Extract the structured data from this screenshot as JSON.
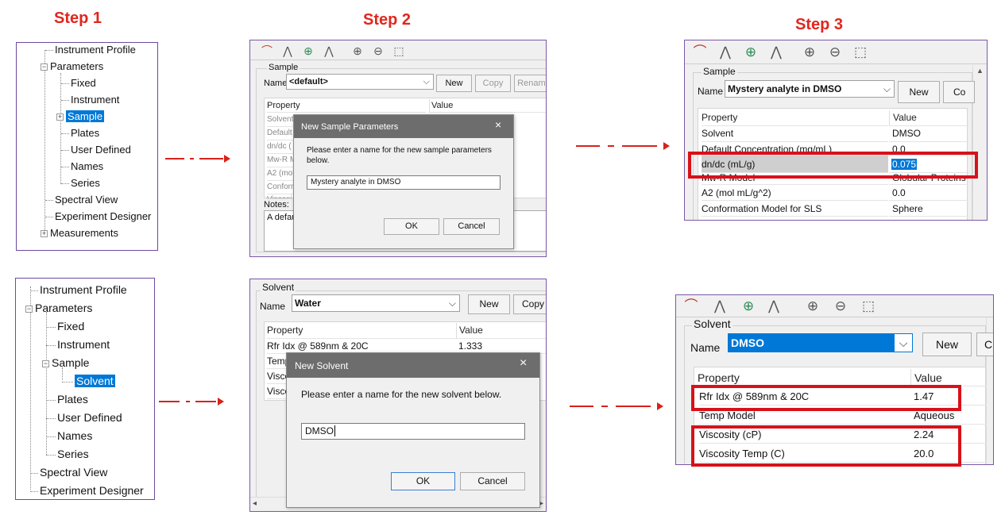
{
  "steps": {
    "s1": "Step 1",
    "s2": "Step 2",
    "s3": "Step 3"
  },
  "colors": {
    "accent_red": "#d8111a",
    "selection": "#0078d7",
    "dialog_title": "#6d6d6d"
  },
  "tree_top": {
    "items": [
      "Instrument Profile",
      "Parameters",
      "Fixed",
      "Instrument",
      "Sample",
      "Plates",
      "User Defined",
      "Names",
      "Series",
      "Spectral View",
      "Experiment Designer",
      "Measurements"
    ],
    "selected": "Sample"
  },
  "tree_bottom": {
    "items": [
      "Instrument Profile",
      "Parameters",
      "Fixed",
      "Instrument",
      "Sample",
      "Solvent",
      "Plates",
      "User Defined",
      "Names",
      "Series",
      "Spectral View",
      "Experiment Designer"
    ],
    "selected": "Solvent"
  },
  "sample_panel": {
    "group_label": "Sample",
    "name_label": "Name",
    "name_value": "<default>",
    "buttons": {
      "new": "New",
      "copy": "Copy",
      "rename": "Rename"
    },
    "col_property": "Property",
    "col_value": "Value",
    "rows_truncated": [
      "Solvent",
      "Default",
      "dn/dc (",
      "Mw-R M",
      "A2 (mol",
      "Conform",
      "Viscosi"
    ],
    "notes_label": "Notes:",
    "notes_text": "A defau"
  },
  "dialog_sample": {
    "title": "New Sample Parameters",
    "close": "×",
    "message": "Please enter a name for the new sample parameters below.",
    "input": "Mystery analyte in DMSO",
    "ok": "OK",
    "cancel": "Cancel"
  },
  "step3_sample": {
    "group_label": "Sample",
    "name_label": "Name",
    "name_value": "Mystery analyte in DMSO",
    "buttons": {
      "new": "New",
      "copy": "Co"
    },
    "col_property": "Property",
    "col_value": "Value",
    "rows": [
      {
        "property": "Solvent",
        "value": "DMSO"
      },
      {
        "property": "Default Concentration (mg/mL)",
        "value": "0.0"
      },
      {
        "property": "dn/dc (mL/g)",
        "value": "0.075"
      },
      {
        "property": "Mw-R Model",
        "value": "Globular Proteins"
      },
      {
        "property": "A2 (mol mL/g^2)",
        "value": "0.0"
      },
      {
        "property": "Conformation Model for SLS",
        "value": "Sphere"
      }
    ]
  },
  "solvent_panel": {
    "group_label": "Solvent",
    "name_label": "Name",
    "name_value": "Water",
    "buttons": {
      "new": "New",
      "copy": "Copy"
    },
    "col_property": "Property",
    "col_value": "Value",
    "rows_truncated": [
      "Rfr Idx @ 589nm & 20C",
      "Temp",
      "Viscos",
      "Visco"
    ],
    "value_first": "1.333"
  },
  "dialog_solvent": {
    "title": "New Solvent",
    "close": "×",
    "message": "Please enter a name for the new solvent below.",
    "input": "DMSO",
    "ok": "OK",
    "cancel": "Cancel"
  },
  "step3_solvent": {
    "group_label": "Solvent",
    "name_label": "Name",
    "name_value": "DMSO",
    "buttons": {
      "new": "New",
      "copy": "C"
    },
    "col_property": "Property",
    "col_value": "Value",
    "rows": [
      {
        "property": "Rfr Idx @ 589nm & 20C",
        "value": "1.47"
      },
      {
        "property": "Temp Model",
        "value": "Aqueous"
      },
      {
        "property": "Viscosity (cP)",
        "value": "2.24"
      },
      {
        "property": "Viscosity Temp (C)",
        "value": "20.0"
      }
    ]
  }
}
